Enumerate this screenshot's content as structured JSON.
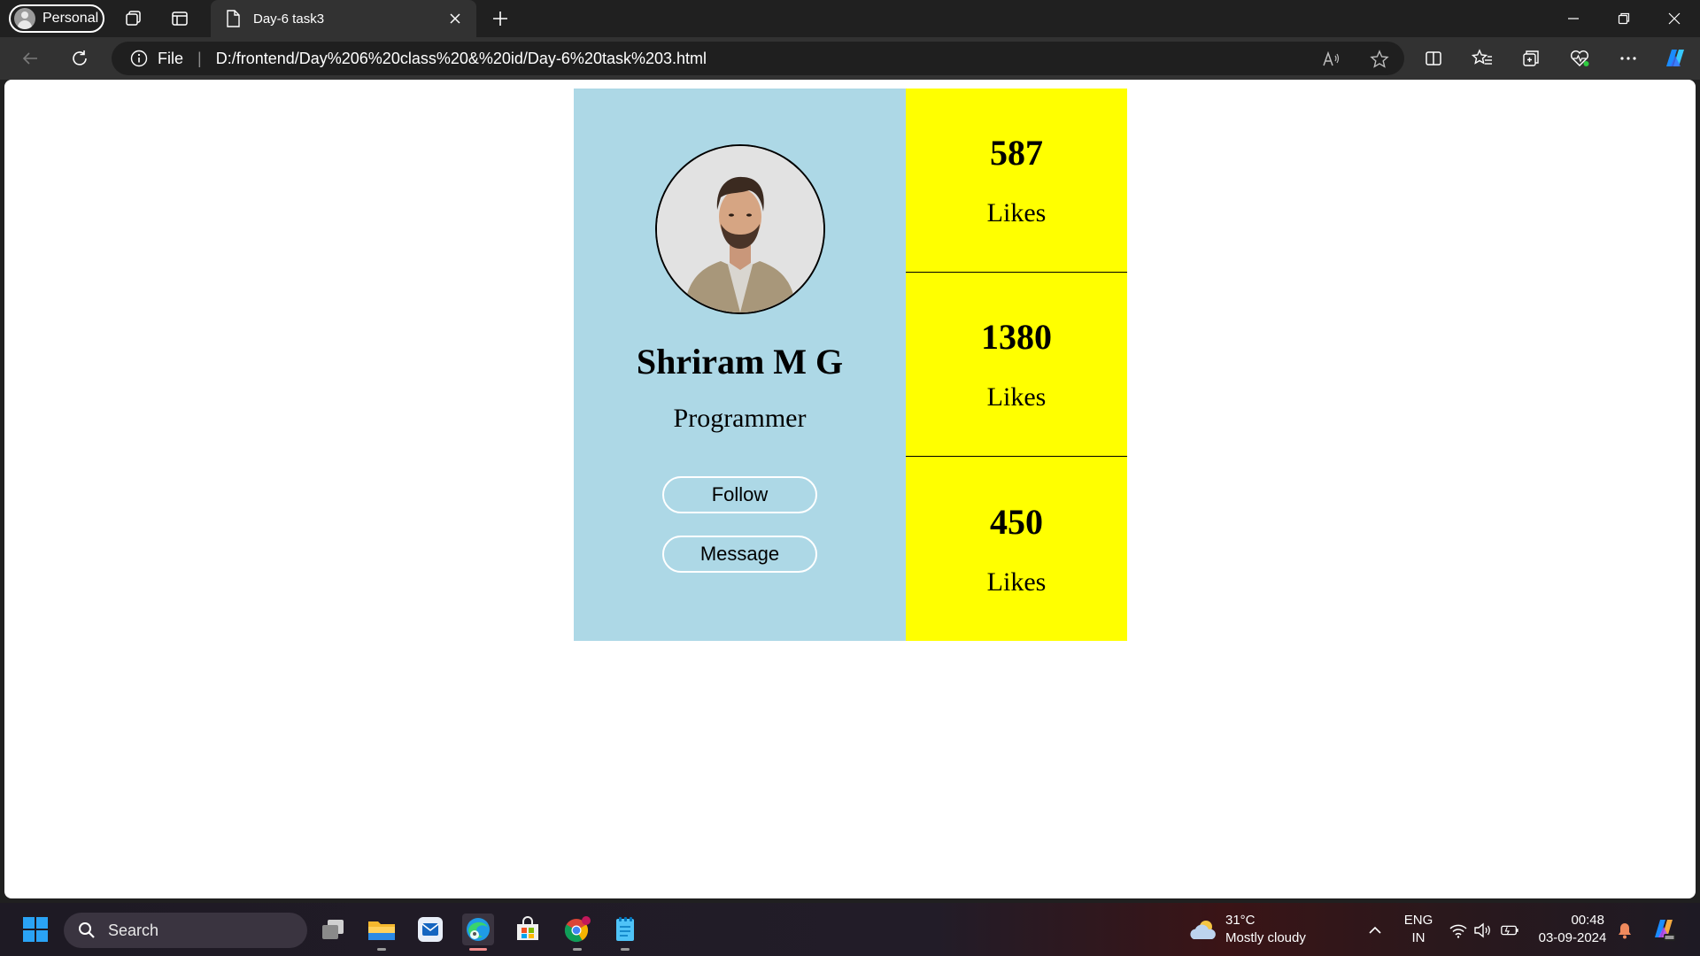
{
  "browser": {
    "profile_label": "Personal",
    "tab_title": "Day-6 task3",
    "address_scheme_label": "File",
    "address_separator": "|",
    "url": "D:/frontend/Day%206%20class%20&%20id/Day-6%20task%203.html"
  },
  "profile_card": {
    "name": "Shriram M G",
    "role": "Programmer",
    "follow_label": "Follow",
    "message_label": "Message",
    "stats": [
      {
        "value": "587",
        "label": "Likes"
      },
      {
        "value": "1380",
        "label": "Likes"
      },
      {
        "value": "450",
        "label": "Likes"
      }
    ],
    "colors": {
      "left_panel": "#add8e6",
      "right_panel": "#ffff00"
    }
  },
  "taskbar": {
    "search_placeholder": "Search",
    "weather_temp": "31°C",
    "weather_desc": "Mostly cloudy",
    "lang_top": "ENG",
    "lang_bottom": "IN",
    "time": "00:48",
    "date": "03-09-2024"
  },
  "icons": {
    "titlebar": [
      "workspaces-icon",
      "vertical-tabs-icon",
      "new-tab-icon",
      "minimize-icon",
      "restore-icon",
      "close-window-icon"
    ],
    "navbar": [
      "back-icon",
      "refresh-icon",
      "info-icon",
      "read-aloud-icon",
      "favorite-star-icon",
      "split-screen-icon",
      "favorites-icon",
      "collections-icon",
      "browser-essentials-icon",
      "more-icon",
      "copilot-icon"
    ],
    "taskbar": [
      "windows-start-icon",
      "search-icon",
      "task-view-icon",
      "file-explorer-icon",
      "mail-app-icon",
      "edge-icon",
      "store-icon",
      "chrome-icon",
      "notepad-icon",
      "chevron-up-icon",
      "wifi-icon",
      "volume-icon",
      "battery-icon",
      "notification-bell-icon",
      "copilot-taskbar-icon"
    ]
  }
}
